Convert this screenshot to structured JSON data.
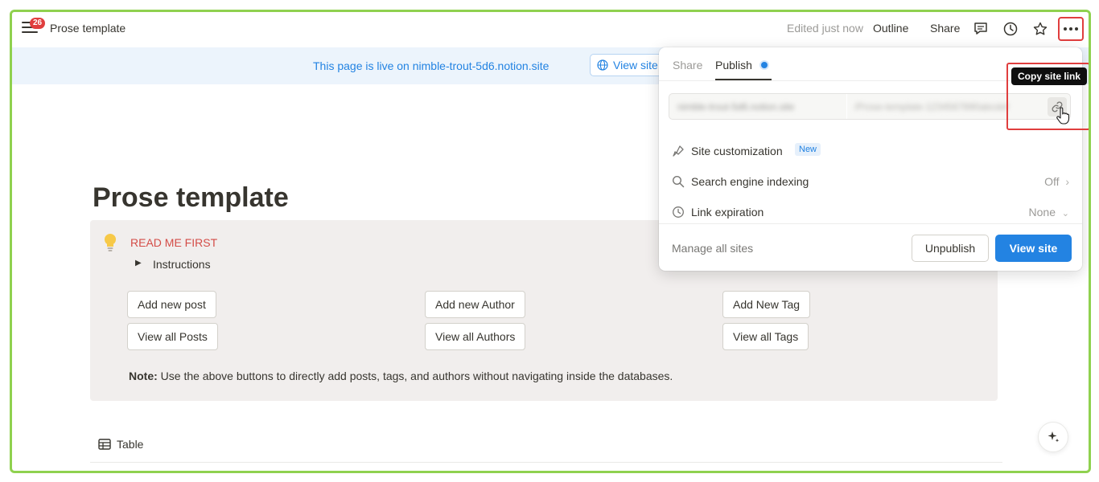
{
  "topbar": {
    "notification_count": "26",
    "page_title": "Prose template",
    "edited_status": "Edited just now",
    "outline_label": "Outline",
    "share_label": "Share"
  },
  "banner": {
    "live_text": "This page is live on nimble-trout-5d6.notion.site",
    "view_site_label": "View site"
  },
  "page": {
    "title": "Prose template",
    "callout": {
      "heading": "READ ME FIRST",
      "toggle_label": "Instructions",
      "buttons": {
        "add_post": "Add new post",
        "view_posts": "View all Posts",
        "add_author": "Add new Author",
        "view_authors": "View all Authors",
        "add_tag": "Add New Tag",
        "view_tags": "View all Tags"
      },
      "note_label": "Note:",
      "note_text": " Use the above buttons to directly add posts, tags, and authors without navigating inside the databases."
    },
    "table_label": "Table"
  },
  "popover": {
    "tab_share": "Share",
    "tab_publish": "Publish",
    "site_customization": "Site customization",
    "new_badge": "New",
    "search_indexing": "Search engine indexing",
    "search_indexing_value": "Off",
    "link_expiration": "Link expiration",
    "link_expiration_value": "None",
    "manage_sites": "Manage all sites",
    "unpublish_label": "Unpublish",
    "view_site_label": "View site"
  },
  "tooltip": {
    "copy_link": "Copy site link"
  },
  "colors": {
    "accent": "#2383e2",
    "highlight": "#e03e3e",
    "frame": "#8fd14f",
    "callout_bg": "#f1eeed"
  }
}
